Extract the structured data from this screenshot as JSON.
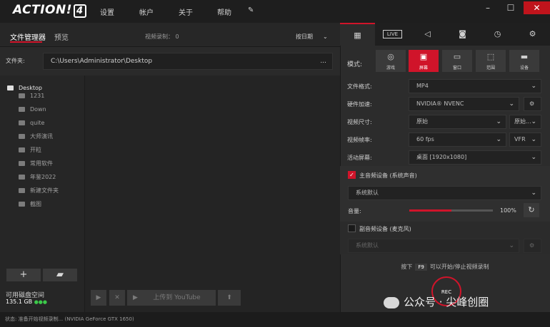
{
  "app": {
    "logo": "ACTION!",
    "version": "4",
    "menu": [
      "设置",
      "帐户",
      "关于",
      "帮助"
    ]
  },
  "left": {
    "tabs": {
      "files": "文件管理器",
      "preview": "预览"
    },
    "video_count_label": "视频录制：",
    "video_count": "0",
    "sort_label": "按日期",
    "folder_label": "文件夹:",
    "folder_path": "C:\\Users\\Administrator\\Desktop",
    "folder_more": "...",
    "tree": {
      "root": "Desktop",
      "items": [
        "1231",
        "Down",
        "quite",
        "大师演讯",
        "开粒",
        "常用软件",
        "年鉴2022",
        "新建文件夹",
        "截图"
      ]
    },
    "disk_label": "可用磁盘空间",
    "disk_value": "135.1 GB",
    "upload_label": "上传到 YouTube"
  },
  "status": {
    "label": "状态:",
    "text": "准备开始视频录制... (NVIDIA GeForce GTX 1650)"
  },
  "right": {
    "tabs": [
      "video",
      "LIVE",
      "audio",
      "camera",
      "timer",
      "settings"
    ],
    "live_label": "LIVE",
    "mode_label": "模式:",
    "modes": [
      {
        "label": "游戏",
        "icon": "gamepad-icon"
      },
      {
        "label": "屏幕",
        "icon": "screen-icon"
      },
      {
        "label": "窗口",
        "icon": "window-icon"
      },
      {
        "label": "范围",
        "icon": "region-icon"
      },
      {
        "label": "设备",
        "icon": "device-icon"
      }
    ],
    "rows": [
      {
        "label": "文件格式:",
        "value": "MP4"
      },
      {
        "label": "硬件加速:",
        "value": "NVIDIA® NVENC"
      },
      {
        "label": "视频尺寸:",
        "value": "原始",
        "value2": "原始..."
      },
      {
        "label": "视频帧率:",
        "value": "60 fps",
        "value2": "VFR"
      },
      {
        "label": "活动屏幕:",
        "value": "桌面 [1920x1080]"
      }
    ],
    "audio": {
      "main_label": "主音频设备 (系统声音)",
      "main_device": "系统默认",
      "volume_label": "音量:",
      "volume_value": "100%",
      "volume_fraction": 0.5
    },
    "mic": {
      "label": "副音频设备 (麦克风)",
      "device": "系统默认"
    },
    "hint_before": "按下",
    "hint_key": "F9",
    "hint_after": "可以开始/停止视频录制",
    "rec_label": "REC"
  },
  "watermark": "公众号 · 尖峰创圈",
  "colors": {
    "accent": "#d0142a"
  }
}
